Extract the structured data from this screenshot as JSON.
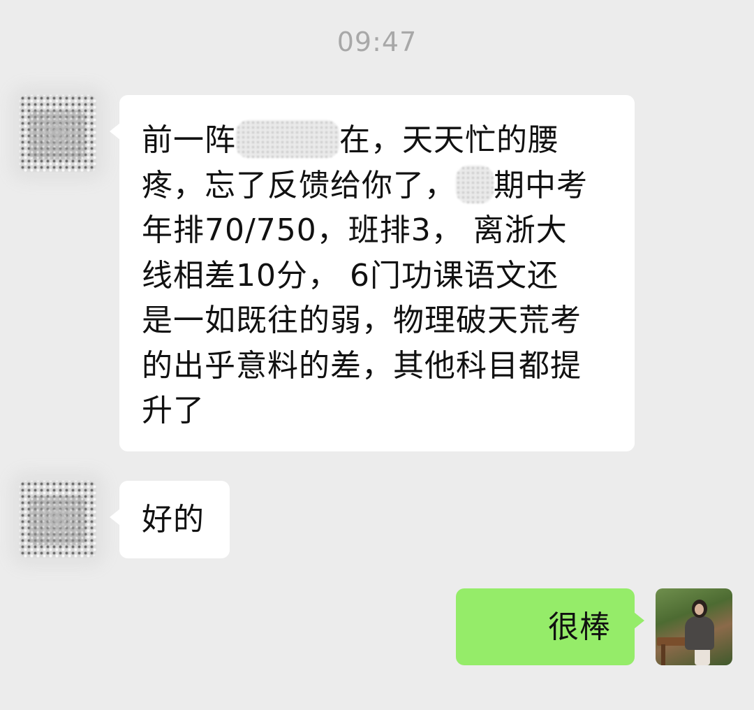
{
  "timestamp": "09:47",
  "messages": [
    {
      "side": "left",
      "lines": [
        {
          "before": "前一阵",
          "redacted": "name",
          "after": "在，天天忙的腰"
        },
        {
          "before": "疼，忘了反馈给你了，",
          "redacted": "char",
          "after": "期中考"
        },
        {
          "before": "年排70/750，班排3， 离浙大",
          "redacted": null,
          "after": ""
        },
        {
          "before": "线相差10分， 6门功课语文还",
          "redacted": null,
          "after": ""
        },
        {
          "before": "是一如既往的弱，物理破天荒考",
          "redacted": null,
          "after": ""
        },
        {
          "before": "的出乎意料的差，其他科目都提",
          "redacted": null,
          "after": ""
        },
        {
          "before": "升了",
          "redacted": null,
          "after": ""
        }
      ]
    },
    {
      "side": "left",
      "text": "好的"
    },
    {
      "side": "right",
      "text": "很棒"
    }
  ],
  "colors": {
    "background": "#ececec",
    "bubble_left": "#ffffff",
    "bubble_right": "#95ec69",
    "timestamp": "#a8a8a8"
  }
}
